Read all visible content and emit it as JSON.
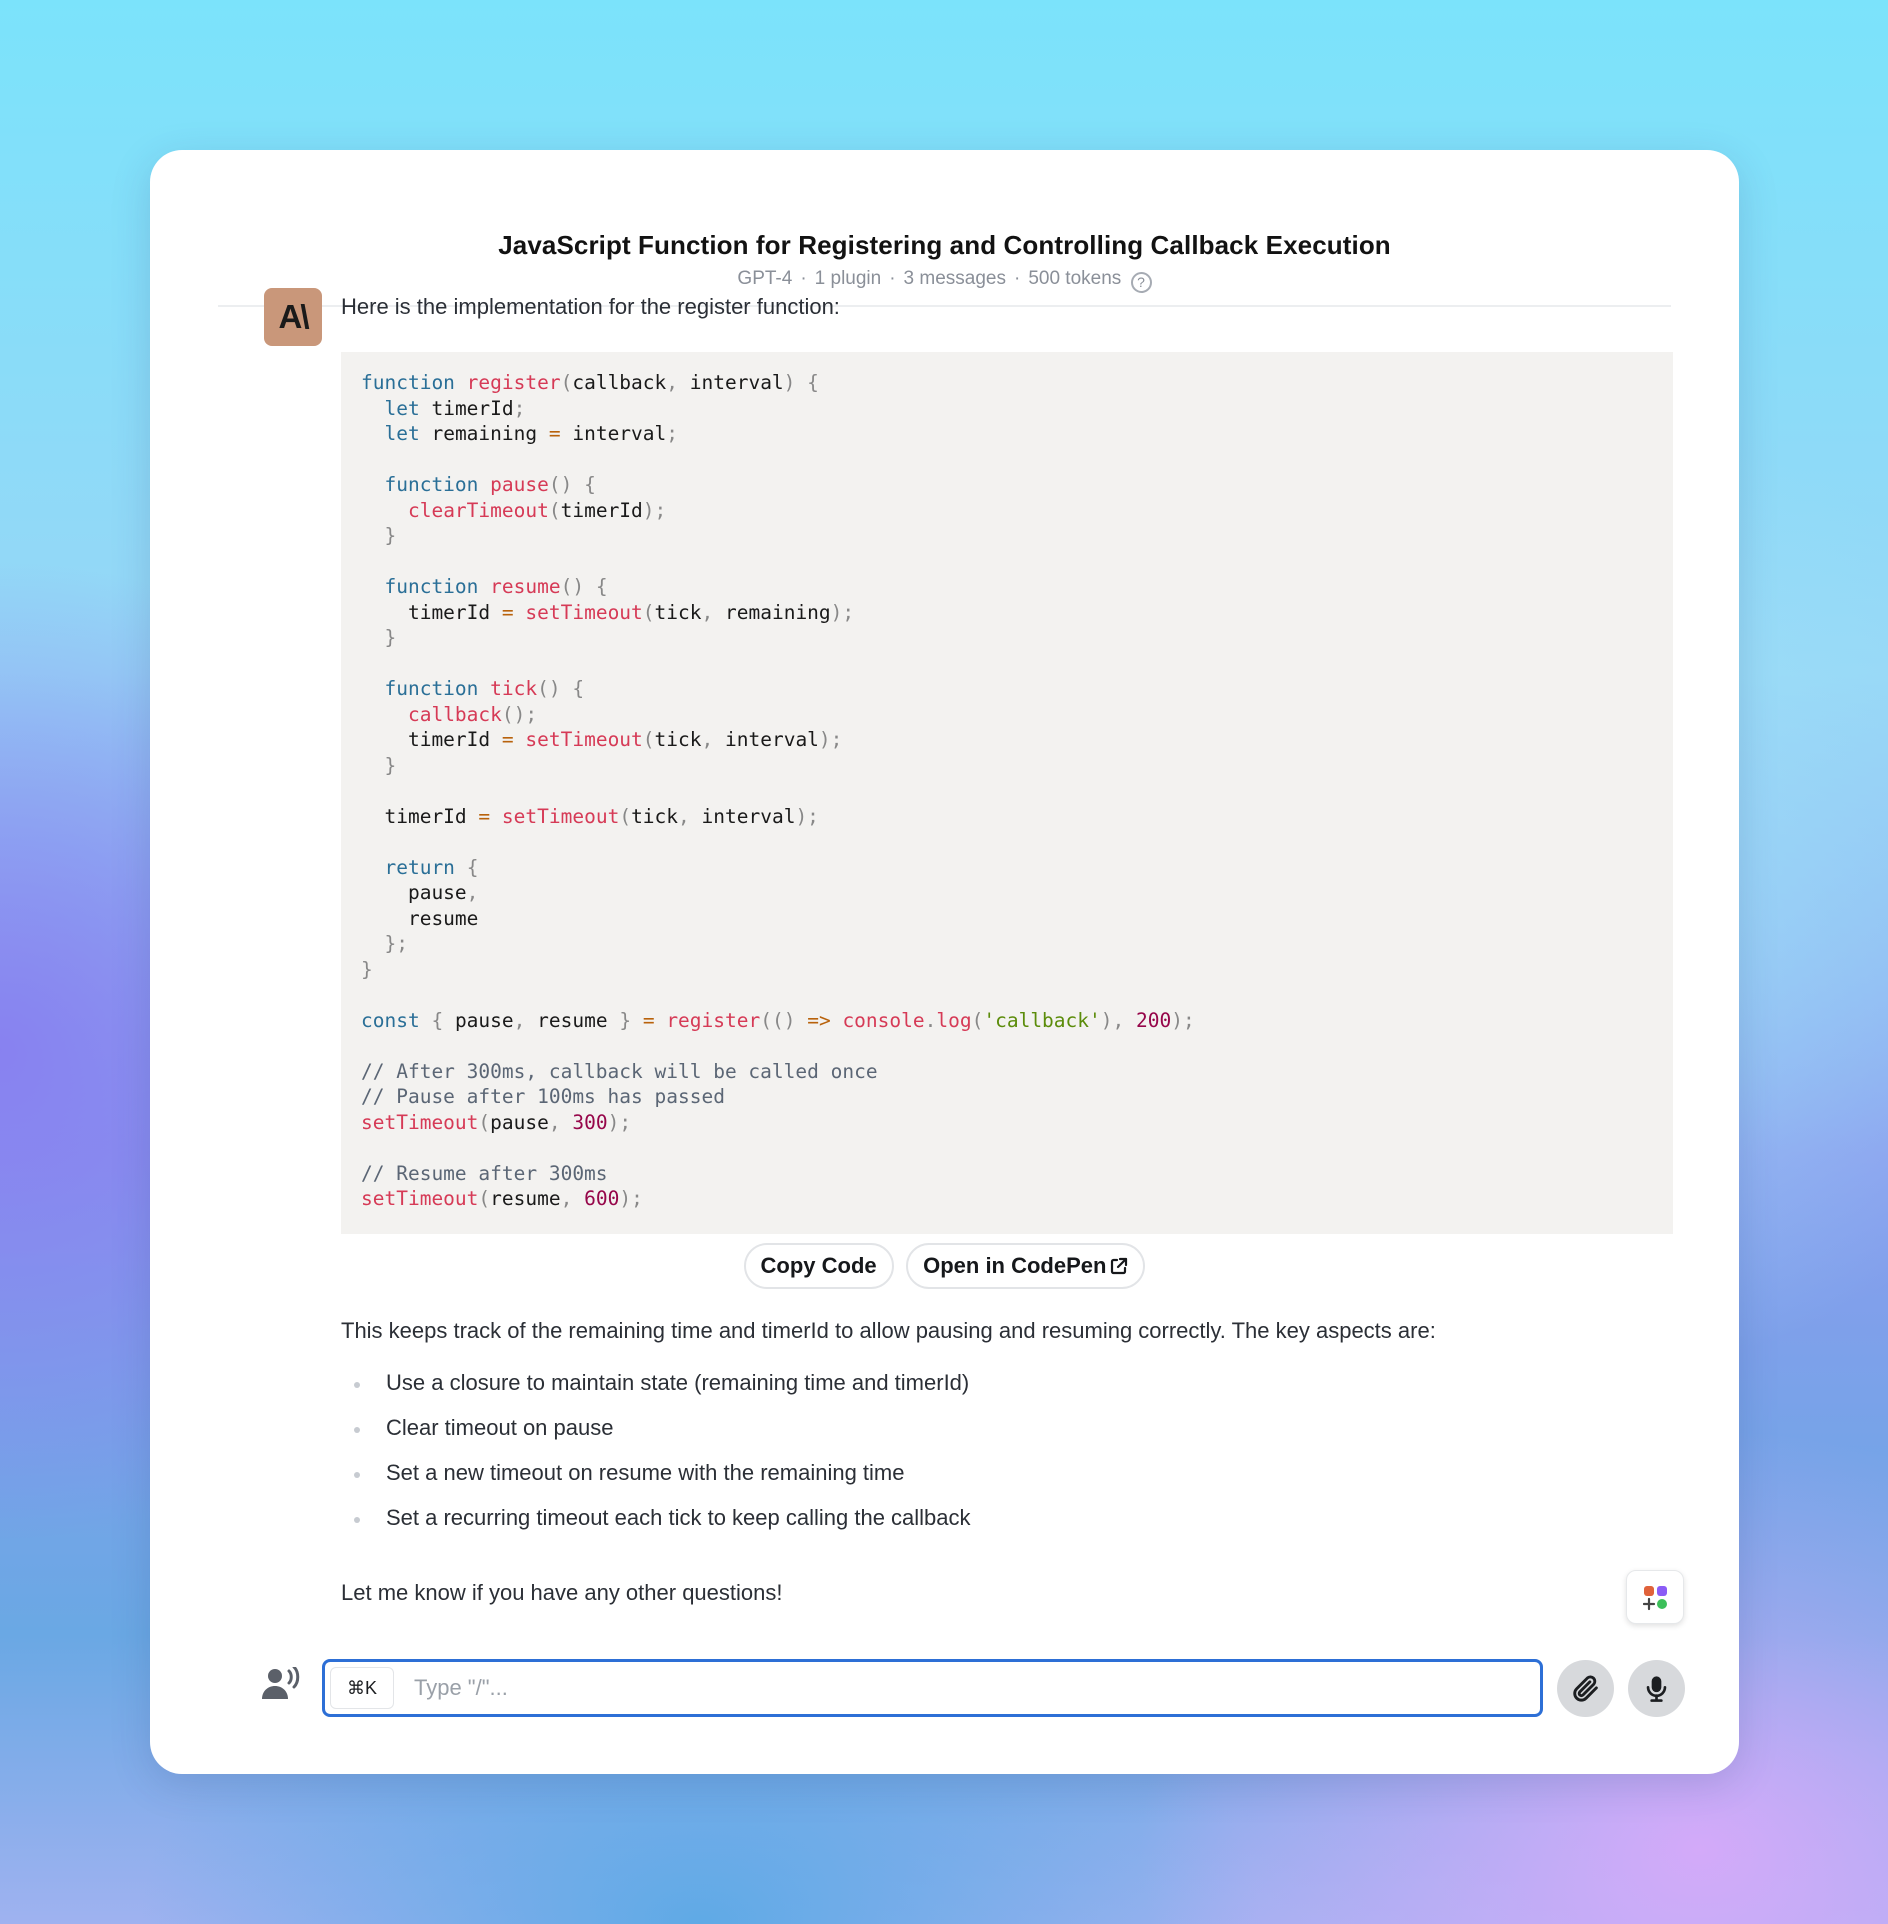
{
  "header": {
    "title": "JavaScript Function for Registering and Controlling Callback Execution",
    "model": "GPT-4",
    "plugins": "1 plugin",
    "messages": "3 messages",
    "tokens": "500 tokens",
    "help_icon": "question-circle-icon"
  },
  "message": {
    "avatar_text": "A\\",
    "intro": "Here is the implementation for the register function:",
    "code_lines": [
      [
        [
          "kw",
          "function"
        ],
        [
          "t",
          " "
        ],
        [
          "fn",
          "register"
        ],
        [
          "p",
          "("
        ],
        [
          "t",
          "callback"
        ],
        [
          "p",
          ", "
        ],
        [
          "t",
          "interval"
        ],
        [
          "p",
          ") {"
        ]
      ],
      [
        [
          "t",
          "  "
        ],
        [
          "kw",
          "let"
        ],
        [
          "t",
          " timerId"
        ],
        [
          "p",
          ";"
        ]
      ],
      [
        [
          "t",
          "  "
        ],
        [
          "kw",
          "let"
        ],
        [
          "t",
          " remaining "
        ],
        [
          "op",
          "="
        ],
        [
          "t",
          " interval"
        ],
        [
          "p",
          ";"
        ]
      ],
      [],
      [
        [
          "t",
          "  "
        ],
        [
          "kw",
          "function"
        ],
        [
          "t",
          " "
        ],
        [
          "fn",
          "pause"
        ],
        [
          "p",
          "() {"
        ]
      ],
      [
        [
          "t",
          "    "
        ],
        [
          "fn",
          "clearTimeout"
        ],
        [
          "p",
          "("
        ],
        [
          "t",
          "timerId"
        ],
        [
          "p",
          ");"
        ]
      ],
      [
        [
          "p",
          "  }"
        ]
      ],
      [],
      [
        [
          "t",
          "  "
        ],
        [
          "kw",
          "function"
        ],
        [
          "t",
          " "
        ],
        [
          "fn",
          "resume"
        ],
        [
          "p",
          "() {"
        ]
      ],
      [
        [
          "t",
          "    timerId "
        ],
        [
          "op",
          "="
        ],
        [
          "t",
          " "
        ],
        [
          "fn",
          "setTimeout"
        ],
        [
          "p",
          "("
        ],
        [
          "t",
          "tick"
        ],
        [
          "p",
          ", "
        ],
        [
          "t",
          "remaining"
        ],
        [
          "p",
          ");"
        ]
      ],
      [
        [
          "p",
          "  }"
        ]
      ],
      [],
      [
        [
          "t",
          "  "
        ],
        [
          "kw",
          "function"
        ],
        [
          "t",
          " "
        ],
        [
          "fn",
          "tick"
        ],
        [
          "p",
          "() {"
        ]
      ],
      [
        [
          "t",
          "    "
        ],
        [
          "fn",
          "callback"
        ],
        [
          "p",
          "();"
        ]
      ],
      [
        [
          "t",
          "    timerId "
        ],
        [
          "op",
          "="
        ],
        [
          "t",
          " "
        ],
        [
          "fn",
          "setTimeout"
        ],
        [
          "p",
          "("
        ],
        [
          "t",
          "tick"
        ],
        [
          "p",
          ", "
        ],
        [
          "t",
          "interval"
        ],
        [
          "p",
          ");"
        ]
      ],
      [
        [
          "p",
          "  }"
        ]
      ],
      [],
      [
        [
          "t",
          "  timerId "
        ],
        [
          "op",
          "="
        ],
        [
          "t",
          " "
        ],
        [
          "fn",
          "setTimeout"
        ],
        [
          "p",
          "("
        ],
        [
          "t",
          "tick"
        ],
        [
          "p",
          ", "
        ],
        [
          "t",
          "interval"
        ],
        [
          "p",
          ");"
        ]
      ],
      [],
      [
        [
          "t",
          "  "
        ],
        [
          "kw",
          "return"
        ],
        [
          "t",
          " "
        ],
        [
          "p",
          "{"
        ]
      ],
      [
        [
          "t",
          "    pause"
        ],
        [
          "p",
          ","
        ]
      ],
      [
        [
          "t",
          "    resume"
        ]
      ],
      [
        [
          "p",
          "  };"
        ]
      ],
      [
        [
          "p",
          "}"
        ]
      ],
      [],
      [
        [
          "kw",
          "const"
        ],
        [
          "t",
          " "
        ],
        [
          "p",
          "{ "
        ],
        [
          "t",
          "pause"
        ],
        [
          "p",
          ", "
        ],
        [
          "t",
          "resume "
        ],
        [
          "p",
          "}"
        ],
        [
          "t",
          " "
        ],
        [
          "op",
          "="
        ],
        [
          "t",
          " "
        ],
        [
          "fn",
          "register"
        ],
        [
          "p",
          "(() "
        ],
        [
          "op",
          "=>"
        ],
        [
          "t",
          " "
        ],
        [
          "fn",
          "console"
        ],
        [
          "p",
          "."
        ],
        [
          "fn",
          "log"
        ],
        [
          "p",
          "("
        ],
        [
          "str",
          "'callback'"
        ],
        [
          "p",
          "), "
        ],
        [
          "num",
          "200"
        ],
        [
          "p",
          ");"
        ]
      ],
      [],
      [
        [
          "cmt",
          "// After 300ms, callback will be called once"
        ]
      ],
      [
        [
          "cmt",
          "// Pause after 100ms has passed"
        ]
      ],
      [
        [
          "fn",
          "setTimeout"
        ],
        [
          "p",
          "("
        ],
        [
          "t",
          "pause"
        ],
        [
          "p",
          ", "
        ],
        [
          "num",
          "300"
        ],
        [
          "p",
          ");"
        ]
      ],
      [],
      [
        [
          "cmt",
          "// Resume after 300ms"
        ]
      ],
      [
        [
          "fn",
          "setTimeout"
        ],
        [
          "p",
          "("
        ],
        [
          "t",
          "resume"
        ],
        [
          "p",
          ", "
        ],
        [
          "num",
          "600"
        ],
        [
          "p",
          ");"
        ]
      ]
    ],
    "copy_code_label": "Copy Code",
    "open_codepen_label": "Open in CodePen",
    "paragraph": "This keeps track of the remaining time and timerId to allow pausing and resuming correctly. The key aspects are:",
    "bullets": [
      "Use a closure to maintain state (remaining time and timerId)",
      "Clear timeout on pause",
      "Set a new timeout on resume with the remaining time",
      "Set a recurring timeout each tick to keep calling the callback"
    ],
    "outro": "Let me know if you have any other questions!"
  },
  "composer": {
    "shortcut": "⌘K",
    "placeholder": "Type \"/\"...",
    "value": ""
  },
  "colors": {
    "accent": "#2d6fd6",
    "code_bg": "#f3f2f0",
    "keyword": "#2a6f97",
    "function": "#d63a56",
    "string": "#5b8c0a",
    "number": "#96064a",
    "comment": "#5b6675",
    "avatar_bg": "#c9977a"
  }
}
